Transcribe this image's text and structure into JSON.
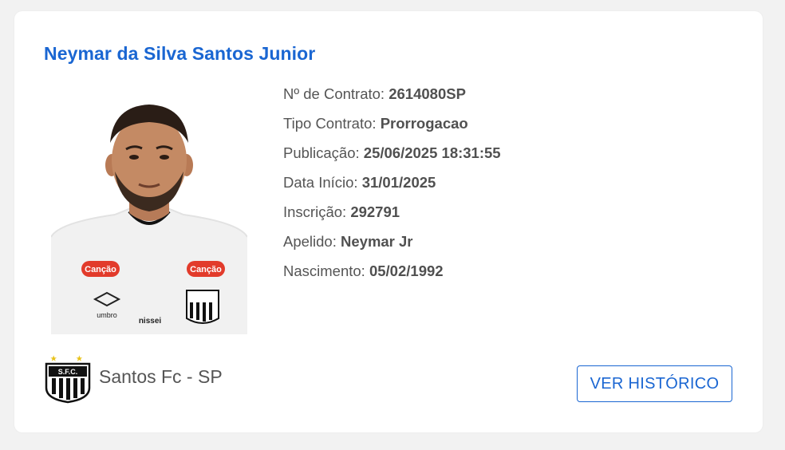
{
  "player": {
    "name": "Neymar da Silva Santos Junior",
    "photo_icon": "player-photo",
    "sponsor_label": "Canção",
    "kit_brand": "umbro",
    "kit_sponsor2": "nissei"
  },
  "details": [
    {
      "label": "Nº de Contrato:",
      "value": "2614080SP"
    },
    {
      "label": "Tipo Contrato:",
      "value": "Prorrogacao"
    },
    {
      "label": "Publicação:",
      "value": "25/06/2025 18:31:55"
    },
    {
      "label": "Data Início:",
      "value": "31/01/2025"
    },
    {
      "label": "Inscrição:",
      "value": "292791"
    },
    {
      "label": "Apelido:",
      "value": "Neymar Jr"
    },
    {
      "label": "Nascimento:",
      "value": "05/02/1992"
    }
  ],
  "club": {
    "name": "Santos Fc - SP",
    "logo_icon": "santos-crest-icon",
    "crest_letters": "S.F.C."
  },
  "actions": {
    "history_label": "VER HISTÓRICO"
  },
  "colors": {
    "accent": "#1a66d2",
    "text": "#555555",
    "background": "#f2f2f2",
    "card": "#ffffff"
  }
}
